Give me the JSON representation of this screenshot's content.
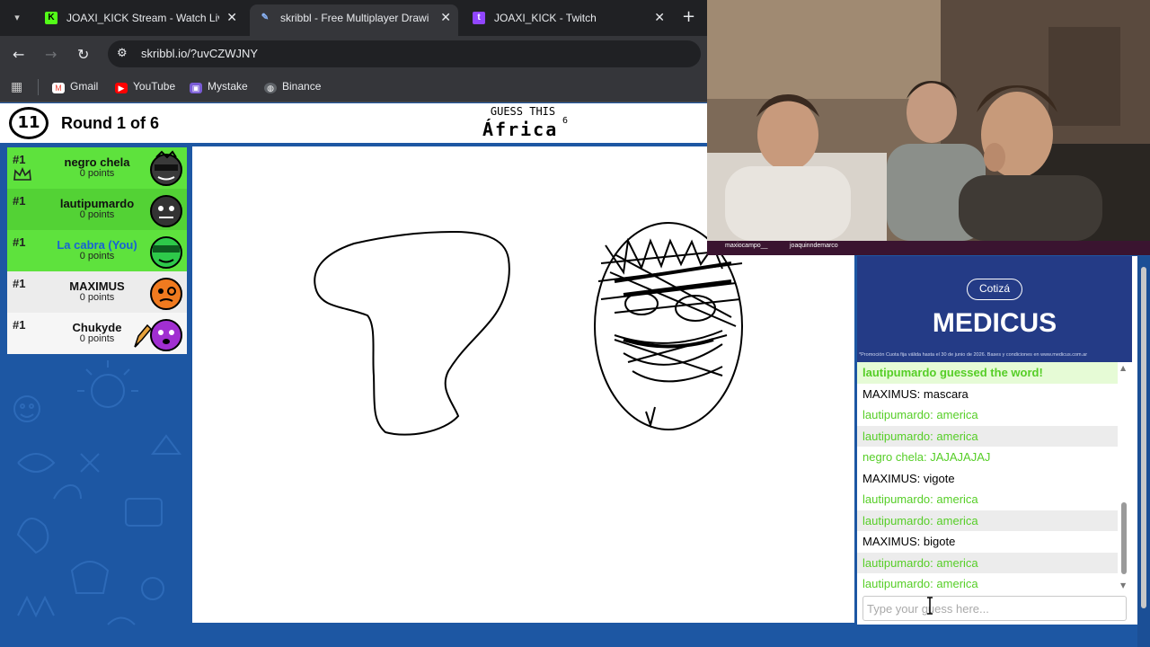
{
  "browser": {
    "tabs": [
      {
        "title": "JOAXI_KICK Stream - Watch Live",
        "active": false,
        "icon": "kick-icon"
      },
      {
        "title": "skribbl - Free Multiplayer Drawi",
        "active": true,
        "icon": "pencil-icon"
      },
      {
        "title": "JOAXI_KICK - Twitch",
        "active": false,
        "icon": "twitch-icon"
      }
    ],
    "url": "skribbl.io/?uvCZWJNY",
    "bookmarks": [
      "Gmail",
      "YouTube",
      "Mystake",
      "Binance"
    ]
  },
  "game": {
    "timer": "11",
    "round": "Round 1 of 6",
    "guess_label": "GUESS THIS",
    "word": "África",
    "word_count": "6"
  },
  "players": [
    {
      "rank": "#1",
      "name": "negro chela",
      "points": "0 points",
      "guessed": true,
      "crown": true,
      "avatar_color": "#3dbb2a"
    },
    {
      "rank": "#1",
      "name": "lautipumardo",
      "points": "0 points",
      "guessed": true,
      "avatar_color": "#333333"
    },
    {
      "rank": "#1",
      "name": "La cabra (You)",
      "points": "0 points",
      "guessed": true,
      "you": true,
      "avatar_color": "#2ec94a"
    },
    {
      "rank": "#1",
      "name": "MAXIMUS",
      "points": "0 points",
      "guessed": false,
      "avatar_color": "#f07a1f"
    },
    {
      "rank": "#1",
      "name": "Chukyde",
      "points": "0 points",
      "guessed": false,
      "drawing": true,
      "avatar_color": "#a12fd1"
    }
  ],
  "ad": {
    "button": "Cotizá",
    "brand": "MEDICUS",
    "fine_print": "*Promoción Cuota fija válida hasta el 30 de junio de 2026. Bases y condiciones en www.medicus.com.ar"
  },
  "chat": {
    "messages": [
      {
        "type": "system",
        "text": "lautipumardo guessed the word!"
      },
      {
        "type": "plain",
        "author": "MAXIMUS:",
        "text": "mascara"
      },
      {
        "type": "green",
        "author": "lautipumardo:",
        "text": "america"
      },
      {
        "type": "green",
        "author": "lautipumardo:",
        "text": "america"
      },
      {
        "type": "green",
        "author": "negro chela:",
        "text": "JAJAJAJAJ"
      },
      {
        "type": "plain",
        "author": "MAXIMUS:",
        "text": "vigote"
      },
      {
        "type": "green",
        "author": "lautipumardo:",
        "text": "america"
      },
      {
        "type": "green",
        "author": "lautipumardo:",
        "text": "america"
      },
      {
        "type": "plain",
        "author": "MAXIMUS:",
        "text": "bigote"
      },
      {
        "type": "green",
        "author": "lautipumardo:",
        "text": "america"
      },
      {
        "type": "green",
        "author": "lautipumardo:",
        "text": "america"
      }
    ],
    "input_placeholder": "Type your guess here..."
  },
  "webcam": {
    "tags": [
      "maxiocampo__",
      "joaquinndemarco"
    ]
  },
  "colors": {
    "guessed_green": "#5ee23d",
    "chat_green": "#56ce27",
    "you_blue": "#1762d5",
    "page_blue": "#1d57a3",
    "ad_blue": "#243b86"
  }
}
